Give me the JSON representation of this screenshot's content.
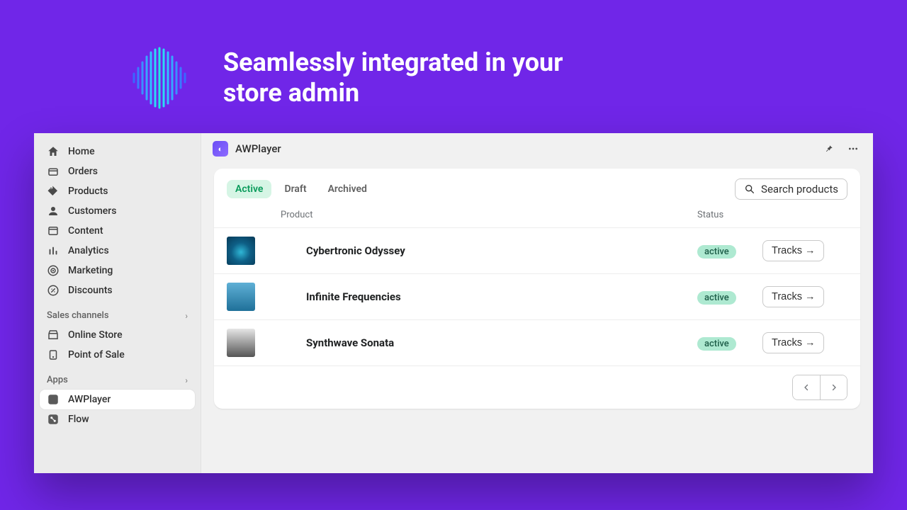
{
  "hero": {
    "title": "Seamlessly integrated in your store admin"
  },
  "sidebar": {
    "primary": [
      {
        "label": "Home",
        "icon": "home"
      },
      {
        "label": "Orders",
        "icon": "orders"
      },
      {
        "label": "Products",
        "icon": "products"
      },
      {
        "label": "Customers",
        "icon": "customers"
      },
      {
        "label": "Content",
        "icon": "content"
      },
      {
        "label": "Analytics",
        "icon": "analytics"
      },
      {
        "label": "Marketing",
        "icon": "marketing"
      },
      {
        "label": "Discounts",
        "icon": "discounts"
      }
    ],
    "channels_label": "Sales channels",
    "channels": [
      {
        "label": "Online Store",
        "icon": "store"
      },
      {
        "label": "Point of Sale",
        "icon": "pos"
      }
    ],
    "apps_label": "Apps",
    "apps": [
      {
        "label": "AWPlayer",
        "icon": "appicon",
        "selected": true
      },
      {
        "label": "Flow",
        "icon": "flow"
      }
    ]
  },
  "topbar": {
    "app_name": "AWPlayer"
  },
  "panel": {
    "tabs": [
      {
        "label": "Active",
        "active": true
      },
      {
        "label": "Draft"
      },
      {
        "label": "Archived"
      }
    ],
    "search_placeholder": "Search products",
    "columns": {
      "product": "Product",
      "status": "Status"
    },
    "rows": [
      {
        "name": "Cybertronic Odyssey",
        "status": "active",
        "action": "Tracks"
      },
      {
        "name": "Infinite Frequencies",
        "status": "active",
        "action": "Tracks"
      },
      {
        "name": "Synthwave Sonata",
        "status": "active",
        "action": "Tracks"
      }
    ]
  }
}
